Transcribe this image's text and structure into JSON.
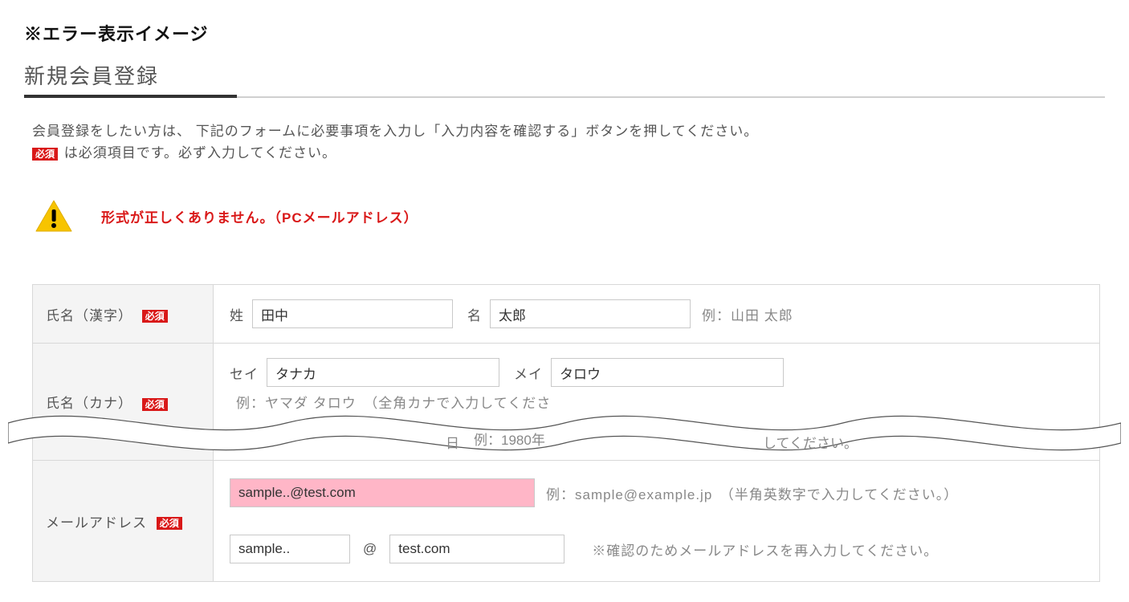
{
  "heading": "※エラー表示イメージ",
  "section_title": "新規会員登録",
  "desc": {
    "line1": "会員登録をしたい方は、 下記のフォームに必要事項を入力し「入力内容を確認する」ボタンを押してください。",
    "line2_after_badge": " は必須項目です。必ず入力してください。"
  },
  "required_badge": "必須",
  "error": {
    "message": "形式が正しくありません。（PCメールアドレス）"
  },
  "form": {
    "name_kanji": {
      "label": "氏名（漢字）",
      "sei_label": "姓",
      "sei_value": "田中",
      "mei_label": "名",
      "mei_value": "太郎",
      "hint": "例：山田 太郎"
    },
    "name_kana": {
      "label": "氏名（カナ）",
      "sei_label": "セイ",
      "sei_value": "タナカ",
      "mei_label": "メイ",
      "mei_value": "タロウ",
      "hint": "例：ヤマダ タロウ　（全角カナで入力してくださ"
    },
    "cut_fragment_left": "日",
    "cut_fragment_mid": "例：1980年",
    "cut_fragment_right": "してください。",
    "email": {
      "label": "メールアドレス",
      "value": "sample..@test.com",
      "hint": "例：sample@example.jp　（半角英数字で入力してください。）",
      "confirm_local": "sample..",
      "at": "@",
      "confirm_domain": "test.com",
      "confirm_hint": "※確認のためメールアドレスを再入力してください。"
    }
  }
}
